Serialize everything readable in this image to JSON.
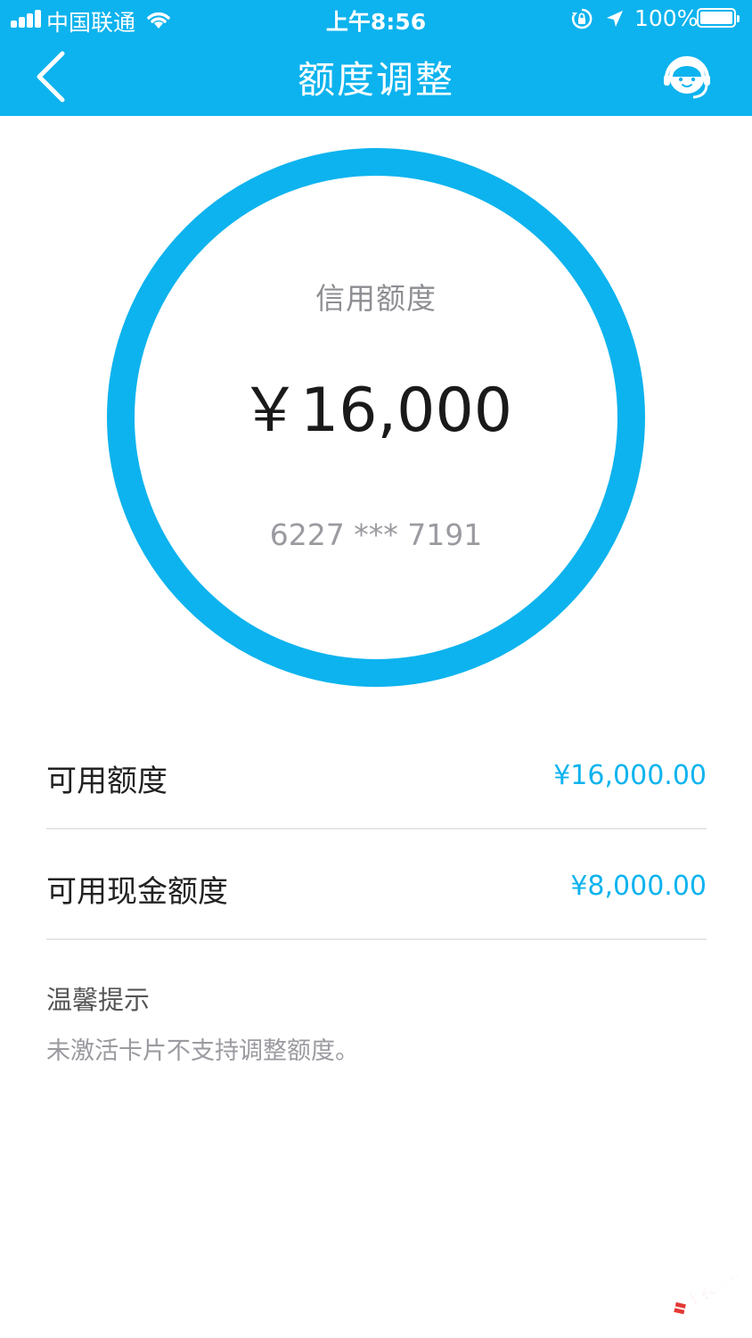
{
  "status_bar": {
    "carrier": "中国联通",
    "time": "上午8:56",
    "battery": "100%",
    "icons": [
      "signal-icon",
      "wifi-icon",
      "rotation-lock-icon",
      "location-arrow-icon",
      "battery-icon"
    ]
  },
  "nav": {
    "back_icon": "chevron-left-icon",
    "title": "额度调整",
    "service_icon": "customer-service-icon"
  },
  "credit": {
    "label": "信用额度",
    "amount": "￥16,000",
    "card_number": "6227 *** 7191"
  },
  "rows": [
    {
      "label": "可用额度",
      "value": "¥16,000.00"
    },
    {
      "label": "可用现金额度",
      "value": "¥8,000.00"
    }
  ],
  "tips": {
    "title": "温馨提示",
    "text": "未激活卡片不支持调整额度。"
  },
  "watermark": {
    "text": "卡农社区"
  },
  "colors": {
    "accent": "#0db3ee",
    "text_dark": "#222222",
    "text_muted": "#9a9aa0",
    "divider": "#e6e6e6"
  }
}
